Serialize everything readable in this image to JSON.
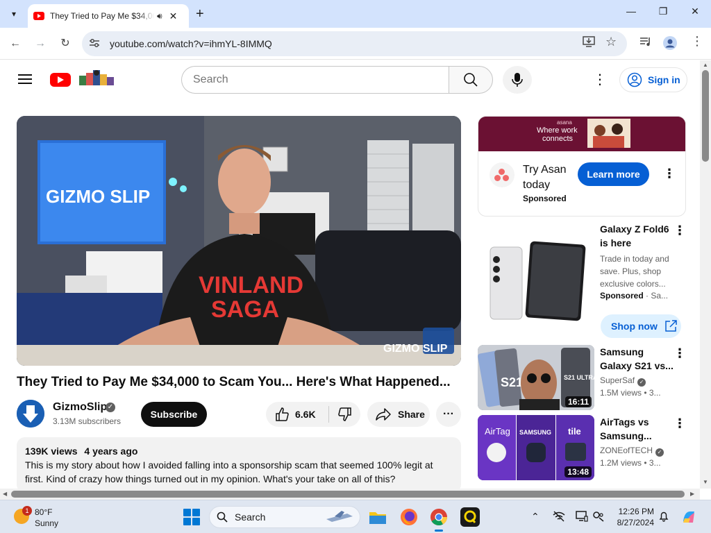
{
  "browser": {
    "tab_title": "They Tried to Pay Me $34,000 to Scam You... Here's What Happened...",
    "url": "youtube.com/watch?v=ihmYL-8IMMQ"
  },
  "header": {
    "search_placeholder": "Search",
    "sign_in": "Sign in"
  },
  "video": {
    "title": "They Tried to Pay Me $34,000 to Scam You... Here's What Happened...",
    "channel": "GizmoSlip",
    "subscribers": "3.13M subscribers",
    "subscribe_label": "Subscribe",
    "likes": "6.6K",
    "share_label": "Share",
    "views": "139K views",
    "age": "4 years ago",
    "description": "This is my story about how I avoided falling into a sponsorship scam that seemed 100% legit at first. Kind of crazy how things turned out in my opinion. What's your take on all of this?"
  },
  "ad": {
    "banner_line1": "Where work",
    "banner_line2": "connects",
    "banner_brand": "asana",
    "title": "Try Asan today",
    "sponsored": "Sponsored",
    "cta": "Learn more"
  },
  "promo": {
    "title": "Galaxy Z Fold6 is here",
    "description": "Trade in today and save. Plus, shop exclusive colors...",
    "sponsored": "Sponsored",
    "advertiser": "Sa...",
    "cta": "Shop now"
  },
  "recommendations": [
    {
      "title": "Samsung Galaxy S21 vs...",
      "channel": "SuperSaf",
      "views": "1.5M views",
      "age": "3...",
      "duration": "16:11"
    },
    {
      "title": "AirTags vs Samsung...",
      "channel": "ZONEofTECH",
      "views": "1.2M views",
      "age": "3...",
      "duration": "13:48"
    }
  ],
  "thumb_labels": {
    "s21": "S21",
    "ultra": "S21 ULTRA",
    "airtag": "AirTag",
    "samsung": "SAMSUNG",
    "tile": "tile"
  },
  "player_overlay": {
    "logo_text": "GIZMO SLIP",
    "shirt_line1": "VINLAND",
    "shirt_line2": "SAGA"
  },
  "taskbar": {
    "temp": "80°F",
    "condition": "Sunny",
    "weather_badge": "1",
    "search": "Search",
    "time": "12:26 PM",
    "date": "8/27/2024"
  },
  "colors": {
    "yt_red": "#ff0000",
    "link_blue": "#065fd4",
    "ad_banner": "#6b1133"
  }
}
